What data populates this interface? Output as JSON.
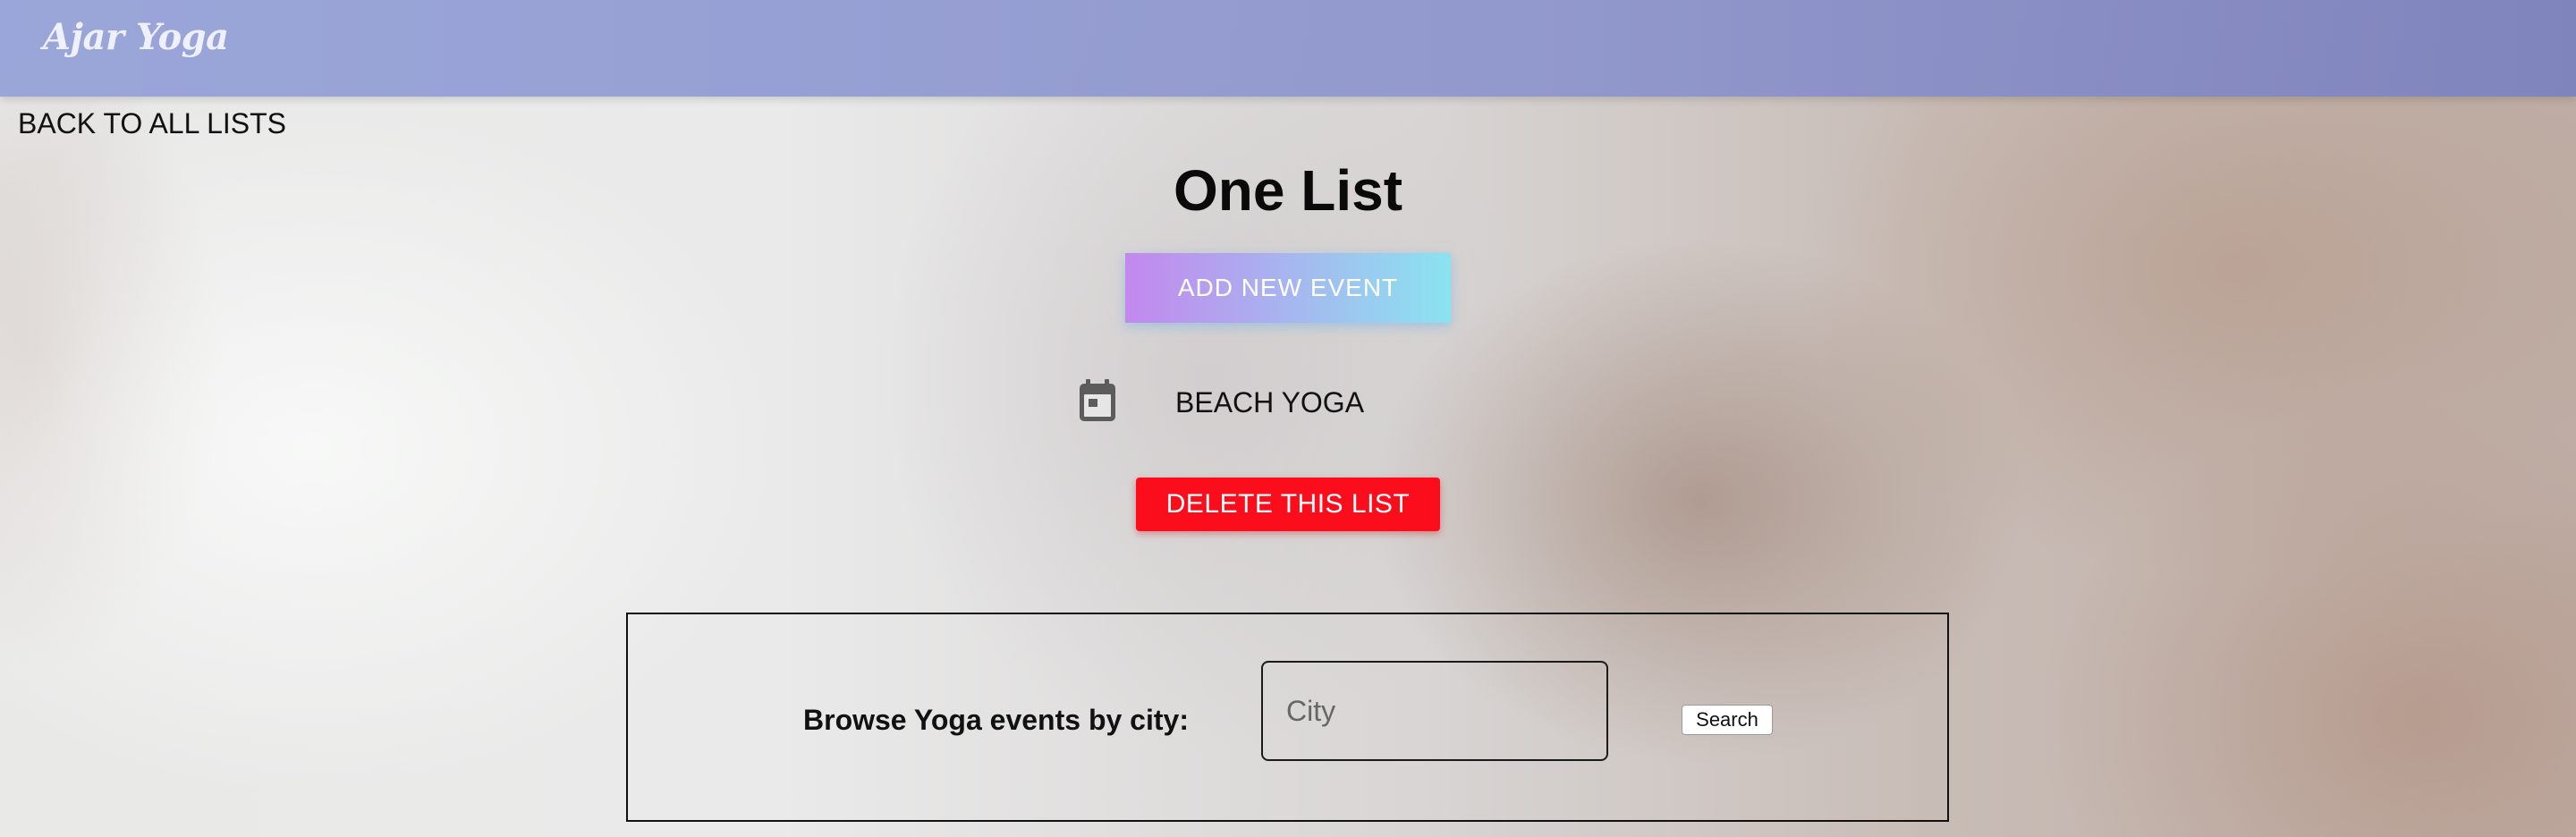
{
  "header": {
    "brand": "Ajar Yoga",
    "background": "#9aa4d8"
  },
  "nav": {
    "back_label": "BACK TO ALL LISTS"
  },
  "main": {
    "title": "One List",
    "add_event_label": "ADD NEW EVENT",
    "events": [
      {
        "icon": "calendar-icon",
        "name": "BEACH YOGA"
      }
    ],
    "delete_label": "DELETE THIS LIST",
    "delete_color": "#fb0d1b",
    "add_gradient": [
      "#c388ee",
      "#8be3f0"
    ]
  },
  "search": {
    "label": "Browse Yoga events by city:",
    "city_placeholder": "City",
    "city_value": "",
    "button_label": "Search"
  }
}
